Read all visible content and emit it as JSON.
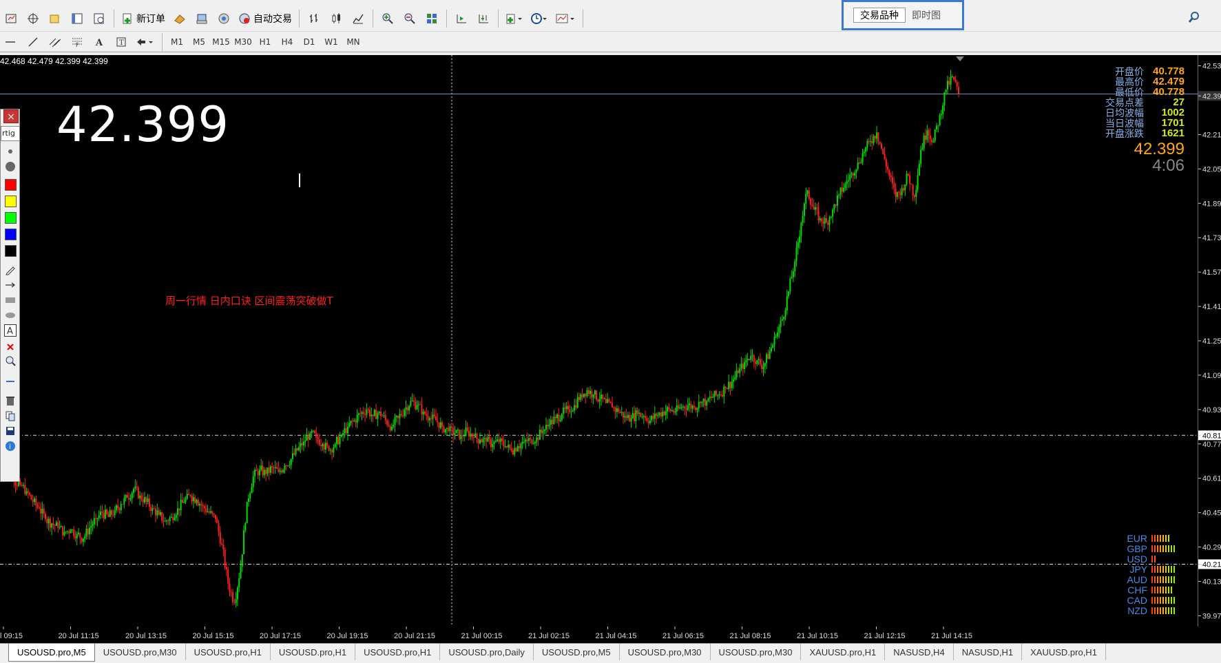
{
  "toolbar": {
    "new_order_label": "新订单",
    "auto_trade_label": "自动交易",
    "timeframes": [
      "M1",
      "M5",
      "M15",
      "M30",
      "H1",
      "H4",
      "D1",
      "W1",
      "MN"
    ]
  },
  "float_box": {
    "tab_symbols": "交易品种",
    "tab_chart": "即时图"
  },
  "chart": {
    "ohlc_text": "42.468 42.479 42.399 42.399",
    "big_price": "42.399",
    "annotation": "周一行情 日内口诀 区间震荡突破做T",
    "info": {
      "open_label": "开盘价",
      "open_value": "40.778",
      "high_label": "最高价",
      "high_value": "42.479",
      "low_label": "最低价",
      "low_value": "40.778",
      "spread_label": "交易点差",
      "spread_value": "27",
      "avg_range_label": "日均波幅",
      "avg_range_value": "1002",
      "today_range_label": "当日波幅",
      "today_range_value": "1701",
      "open_change_label": "开盘涨跌",
      "open_change_value": "1621",
      "price": "42.399",
      "countdown": "4:06"
    },
    "currencies": [
      {
        "name": "EUR",
        "level": 7
      },
      {
        "name": "GBP",
        "level": 9
      },
      {
        "name": "USD",
        "level": 2
      },
      {
        "name": "JPY",
        "level": 9
      },
      {
        "name": "AUD",
        "level": 9
      },
      {
        "name": "CHF",
        "level": 8
      },
      {
        "name": "CAD",
        "level": 9
      },
      {
        "name": "NZD",
        "level": 9
      }
    ],
    "price_scale": [
      "42.53",
      "42.39",
      "42.21",
      "42.05",
      "41.89",
      "41.73",
      "41.57",
      "41.41",
      "41.25",
      "41.09",
      "40.93",
      "40.81",
      "40.77",
      "40.61",
      "40.45",
      "40.29",
      "40.21",
      "40.13",
      "39.97"
    ],
    "time_labels": [
      "l 09:15",
      "20 Jul 11:15",
      "20 Jul 13:15",
      "20 Jul 15:15",
      "20 Jul 17:15",
      "20 Jul 19:15",
      "20 Jul 21:15",
      "21 Jul 00:15",
      "21 Jul 02:15",
      "21 Jul 04:15",
      "21 Jul 06:15",
      "21 Jul 08:15",
      "21 Jul 10:15",
      "21 Jul 12:15",
      "21 Jul 14:15"
    ],
    "colors": {
      "bull": "#00e000",
      "bear": "#ff2020",
      "accent": "#ffa51a",
      "bid_line": "#6f8fb5"
    },
    "candles": [
      40.69,
      40.66,
      40.6,
      40.58,
      40.55,
      40.5,
      40.47,
      40.42,
      40.4,
      40.38,
      40.36,
      40.37,
      40.35,
      40.33,
      40.38,
      40.42,
      40.45,
      40.43,
      40.46,
      40.49,
      40.52,
      40.56,
      40.53,
      40.5,
      40.47,
      40.44,
      40.41,
      40.43,
      40.47,
      40.5,
      40.53,
      40.51,
      40.48,
      40.45,
      40.42,
      40.3,
      40.12,
      40.03,
      40.2,
      40.5,
      40.62,
      40.65,
      40.63,
      40.66,
      40.64,
      40.67,
      40.7,
      40.74,
      40.78,
      40.82,
      40.8,
      40.77,
      40.74,
      40.77,
      40.81,
      40.85,
      40.88,
      40.91,
      40.93,
      40.9,
      40.92,
      40.88,
      40.85,
      40.89,
      40.93,
      40.97,
      40.95,
      40.92,
      40.89,
      40.88,
      40.85,
      40.83,
      40.82,
      40.81,
      40.83,
      40.8,
      40.79,
      40.78,
      40.77,
      40.78,
      40.76,
      40.74,
      40.76,
      40.78,
      40.79,
      40.8,
      40.83,
      40.86,
      40.89,
      40.91,
      40.93,
      40.95,
      41.0,
      41.02,
      41.0,
      40.98,
      40.96,
      40.94,
      40.92,
      40.9,
      40.89,
      40.91,
      40.9,
      40.88,
      40.9,
      40.92,
      40.93,
      40.92,
      40.94,
      40.95,
      40.94,
      40.96,
      40.97,
      40.99,
      41.0,
      41.03,
      41.06,
      41.1,
      41.15,
      41.18,
      41.16,
      41.13,
      41.2,
      41.27,
      41.35,
      41.48,
      41.62,
      41.8,
      41.95,
      41.86,
      41.82,
      41.8,
      41.86,
      41.93,
      41.98,
      42.03,
      42.08,
      42.13,
      42.18,
      42.22,
      42.12,
      42.02,
      41.92,
      41.96,
      42.02,
      41.92,
      42.14,
      42.23,
      42.18,
      42.3,
      42.42,
      42.48,
      42.4
    ]
  }
}
